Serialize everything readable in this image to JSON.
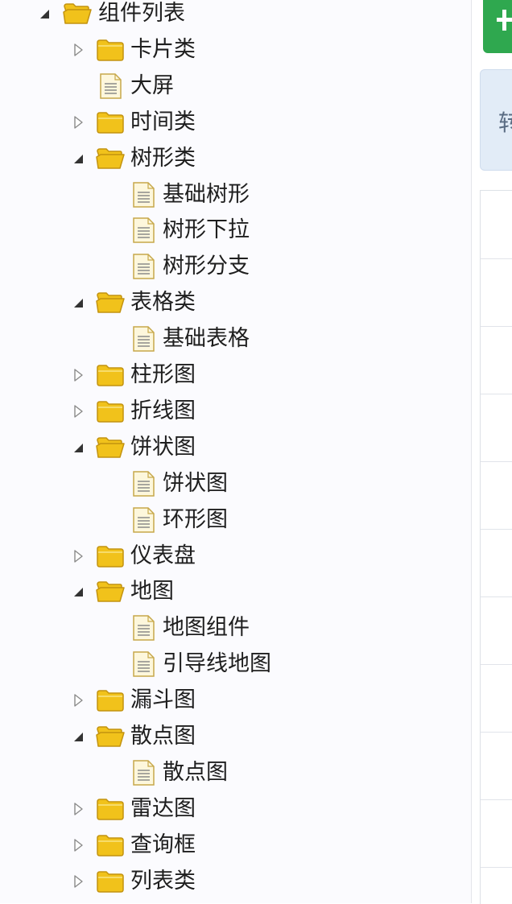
{
  "colors": {
    "folder": "#f1c21b",
    "folder_edge": "#c39310",
    "doc_fill": "#fdf7dc",
    "doc_edge": "#c7a84a",
    "primary_button": "#2fa84f",
    "info_box": "#e2ecf7"
  },
  "icons": {
    "expanded": "triangle-down-icon",
    "collapsed": "triangle-right-icon",
    "folder_closed": "folder-icon",
    "folder_open": "folder-open-icon",
    "document": "document-icon"
  },
  "tree": [
    {
      "label": "组件列表",
      "type": "folder",
      "level": 0,
      "state": "open"
    },
    {
      "label": "卡片类",
      "type": "folder",
      "level": 1,
      "state": "closed"
    },
    {
      "label": "大屏",
      "type": "file",
      "level": 1
    },
    {
      "label": "时间类",
      "type": "folder",
      "level": 1,
      "state": "closed"
    },
    {
      "label": "树形类",
      "type": "folder",
      "level": 1,
      "state": "open"
    },
    {
      "label": "基础树形",
      "type": "file",
      "level": 2
    },
    {
      "label": "树形下拉",
      "type": "file",
      "level": 2
    },
    {
      "label": "树形分支",
      "type": "file",
      "level": 2
    },
    {
      "label": "表格类",
      "type": "folder",
      "level": 1,
      "state": "open"
    },
    {
      "label": "基础表格",
      "type": "file",
      "level": 2
    },
    {
      "label": "柱形图",
      "type": "folder",
      "level": 1,
      "state": "closed"
    },
    {
      "label": "折线图",
      "type": "folder",
      "level": 1,
      "state": "closed"
    },
    {
      "label": "饼状图",
      "type": "folder",
      "level": 1,
      "state": "open"
    },
    {
      "label": "饼状图",
      "type": "file",
      "level": 2
    },
    {
      "label": "环形图",
      "type": "file",
      "level": 2
    },
    {
      "label": "仪表盘",
      "type": "folder",
      "level": 1,
      "state": "closed"
    },
    {
      "label": "地图",
      "type": "folder",
      "level": 1,
      "state": "open"
    },
    {
      "label": "地图组件",
      "type": "file",
      "level": 2
    },
    {
      "label": "引导线地图",
      "type": "file",
      "level": 2
    },
    {
      "label": "漏斗图",
      "type": "folder",
      "level": 1,
      "state": "closed"
    },
    {
      "label": "散点图",
      "type": "folder",
      "level": 1,
      "state": "open"
    },
    {
      "label": "散点图",
      "type": "file",
      "level": 2
    },
    {
      "label": "雷达图",
      "type": "folder",
      "level": 1,
      "state": "closed"
    },
    {
      "label": "查询框",
      "type": "folder",
      "level": 1,
      "state": "closed"
    },
    {
      "label": "列表类",
      "type": "folder",
      "level": 1,
      "state": "closed"
    }
  ],
  "right_panel": {
    "add_button_icon": "plus-icon",
    "info_text": "转"
  }
}
